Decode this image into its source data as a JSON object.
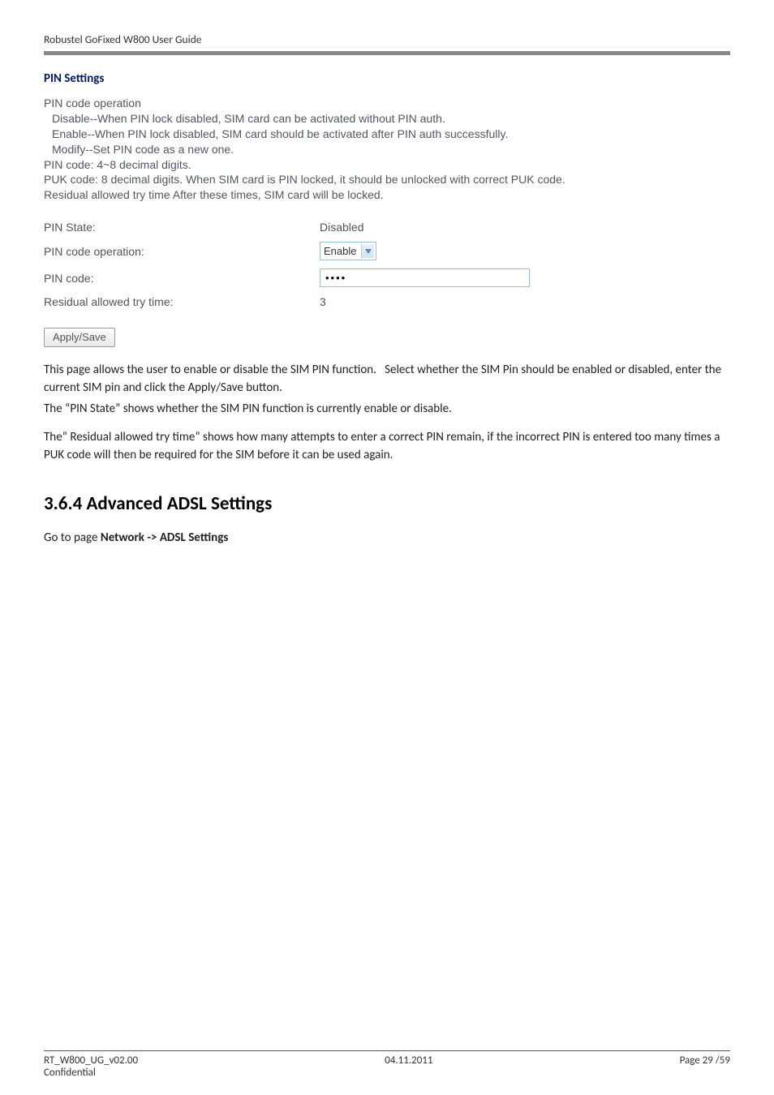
{
  "header": {
    "doc_title": "Robustel GoFixed W800 User Guide"
  },
  "pin_settings": {
    "heading": "PIN Settings",
    "help": {
      "line1": "PIN code operation",
      "line2": "Disable--When PIN lock disabled, SIM card can be activated without PIN auth.",
      "line3": "Enable--When PIN lock disabled, SIM card should be activated after PIN auth successfully.",
      "line4": "Modify--Set PIN code as a new one.",
      "line5": "PIN code: 4~8 decimal digits.",
      "line6": "PUK code: 8 decimal digits. When SIM card is PIN locked, it should be unlocked with correct PUK code.",
      "line7": "Residual allowed try time After these times, SIM card will be locked."
    },
    "form": {
      "pin_state_label": "PIN State:",
      "pin_state_value": "Disabled",
      "pin_code_op_label": "PIN code operation:",
      "pin_code_op_value": "Enable",
      "pin_code_label": "PIN code:",
      "pin_code_value": "••••",
      "resid_label": "Residual allowed try time:",
      "resid_value": "3",
      "apply_button": "Apply/Save"
    }
  },
  "body": {
    "p1": "This page allows the user to enable or disable the SIM PIN function.   Select whether the SIM Pin should be enabled or disabled, enter the current SIM pin and click the Apply/Save button.",
    "p2": "The “PIN State” shows whether the SIM PIN function is currently enable or disable.",
    "p3": "The” Residual allowed try time” shows how many attempts to enter a correct PIN remain, if the incorrect PIN is entered too many times a PUK code will then be required for the SIM before it can be used again."
  },
  "section": {
    "heading": "3.6.4 Advanced ADSL Settings",
    "goto_prefix": "Go to page ",
    "goto_bold": "Network -> ADSL Settings"
  },
  "footer": {
    "left_top": "RT_W800_UG_v02.00",
    "left_bottom": "Confidential",
    "center": "04.11.2011",
    "right": "Page 29 /59"
  }
}
